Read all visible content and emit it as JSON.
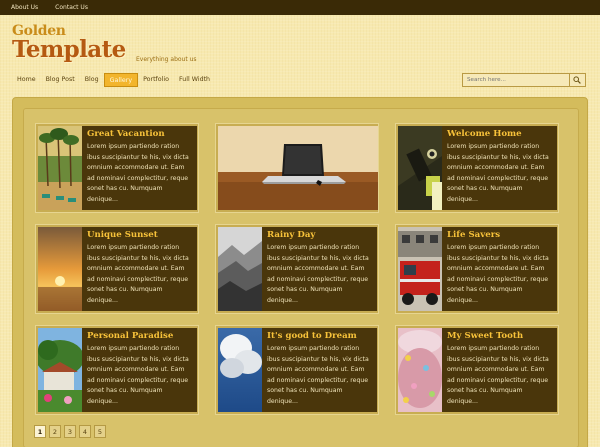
{
  "topbar": {
    "links": [
      "About Us",
      "Contact Us"
    ]
  },
  "logo": {
    "line1": "Golden",
    "line2": "Template"
  },
  "tagline": "Everything about us",
  "nav": {
    "items": [
      "Home",
      "Blog Post",
      "Blog",
      "Gallery",
      "Portfolio",
      "Full Width"
    ],
    "active": "Gallery"
  },
  "search": {
    "placeholder": "Search here..."
  },
  "gallery": {
    "cards": [
      {
        "title": "Great Vacantion",
        "body": "Lorem ipsum partiendo ration ibus suscipiantur te his, vix dicta omnium accommodare ut. Eam ad nominavi complectitur, reque sonet has cu. Numquam denique..."
      },
      {
        "title": "",
        "body": ""
      },
      {
        "title": "Welcome Home",
        "body": "Lorem ipsum partiendo ration ibus suscipiantur te his, vix dicta omnium accommodare ut. Eam ad nominavi complectitur, reque sonet has cu. Numquam denique..."
      },
      {
        "title": "Unique Sunset",
        "body": "Lorem ipsum partiendo ration ibus suscipiantur te his, vix dicta omnium accommodare ut. Eam ad nominavi complectitur, reque sonet has cu. Numquam denique..."
      },
      {
        "title": "Rainy Day",
        "body": "Lorem ipsum partiendo ration ibus suscipiantur te his, vix dicta omnium accommodare ut. Eam ad nominavi complectitur, reque sonet has cu. Numquam denique..."
      },
      {
        "title": "Life Savers",
        "body": "Lorem ipsum partiendo ration ibus suscipiantur te his, vix dicta omnium accommodare ut. Eam ad nominavi complectitur, reque sonet has cu. Numquam denique..."
      },
      {
        "title": "Personal Paradise",
        "body": "Lorem ipsum partiendo ration ibus suscipiantur te his, vix dicta omnium accommodare ut. Eam ad nominavi complectitur, reque sonet has cu. Numquam denique..."
      },
      {
        "title": "It's good to Dream",
        "body": "Lorem ipsum partiendo ration ibus suscipiantur te his, vix dicta omnium accommodare ut. Eam ad nominavi complectitur, reque sonet has cu. Numquam denique..."
      },
      {
        "title": "My Sweet Tooth",
        "body": "Lorem ipsum partiendo ration ibus suscipiantur te his, vix dicta omnium accommodare ut. Eam ad nominavi complectitur, reque sonet has cu. Numquam denique..."
      }
    ]
  },
  "pagination": {
    "pages": [
      "1",
      "2",
      "3",
      "4",
      "5"
    ],
    "current": "1"
  },
  "colors": {
    "accent": "#f2b52d",
    "card_dark": "#4a360b",
    "title_gold": "#f7c23a",
    "topbar": "#3a2a06"
  }
}
